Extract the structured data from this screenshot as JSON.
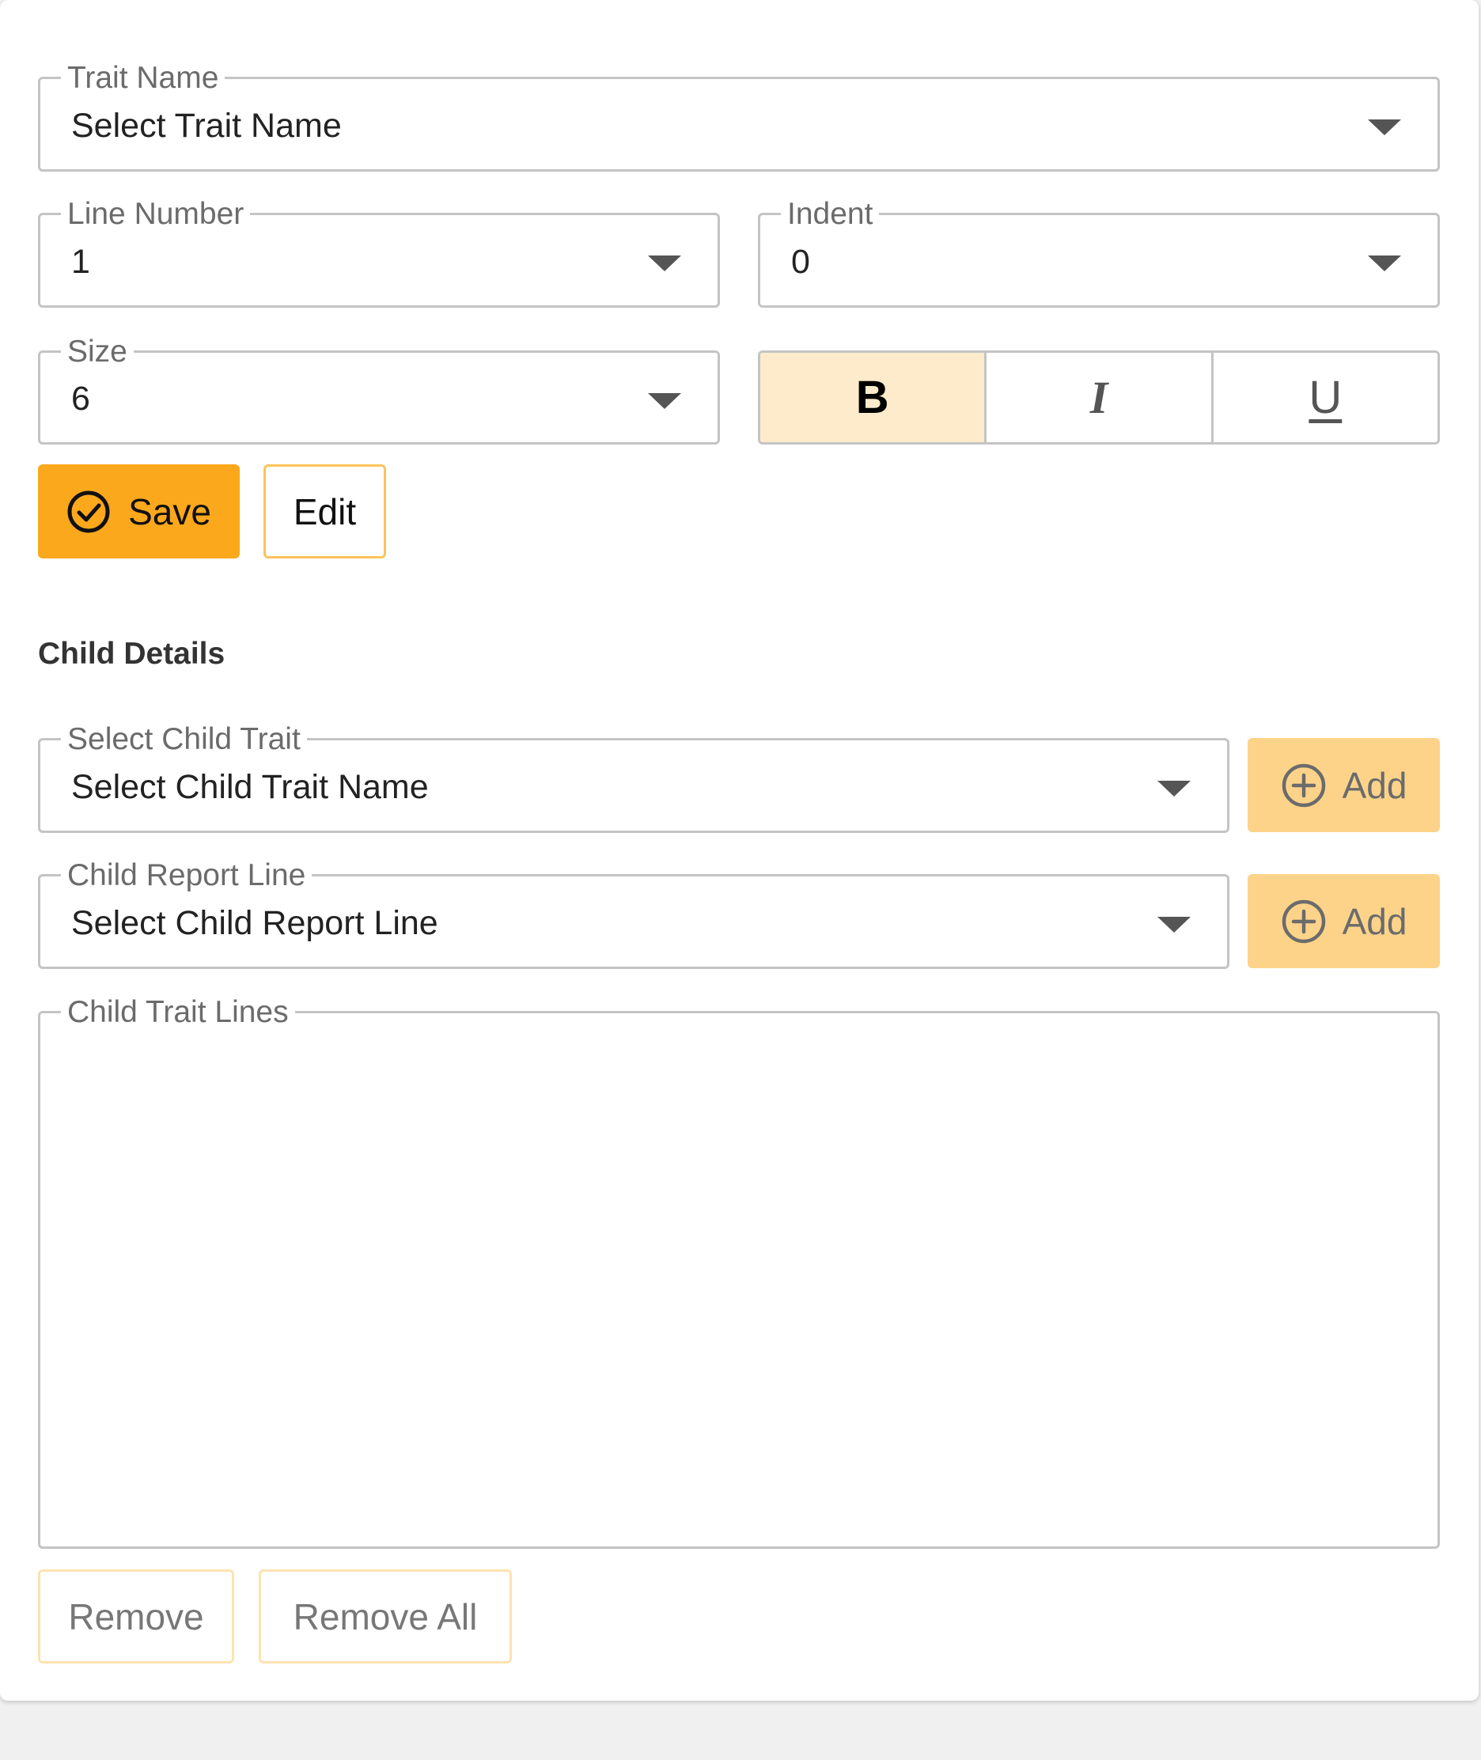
{
  "form": {
    "trait_name": {
      "label": "Trait Name",
      "value": "Select Trait Name"
    },
    "line_number": {
      "label": "Line Number",
      "value": "1"
    },
    "indent": {
      "label": "Indent",
      "value": "0"
    },
    "size": {
      "label": "Size",
      "value": "6"
    },
    "format": {
      "bold_label": "B",
      "italic_label": "I",
      "underline_label": "U",
      "bold_active": true
    },
    "save_label": "Save",
    "edit_label": "Edit"
  },
  "child": {
    "section_title": "Child Details",
    "child_trait": {
      "label": "Select Child Trait",
      "value": "Select Child Trait Name",
      "add_label": "Add"
    },
    "child_report_line": {
      "label": "Child Report Line",
      "value": "Select Child Report Line",
      "add_label": "Add"
    },
    "child_trait_lines": {
      "label": "Child Trait Lines",
      "items": []
    },
    "remove_label": "Remove",
    "remove_all_label": "Remove All"
  },
  "colors": {
    "accent": "#fca81c",
    "accent_light": "#fdd38a",
    "active_toggle": "#fdebcb",
    "border": "#c4c4c4"
  }
}
